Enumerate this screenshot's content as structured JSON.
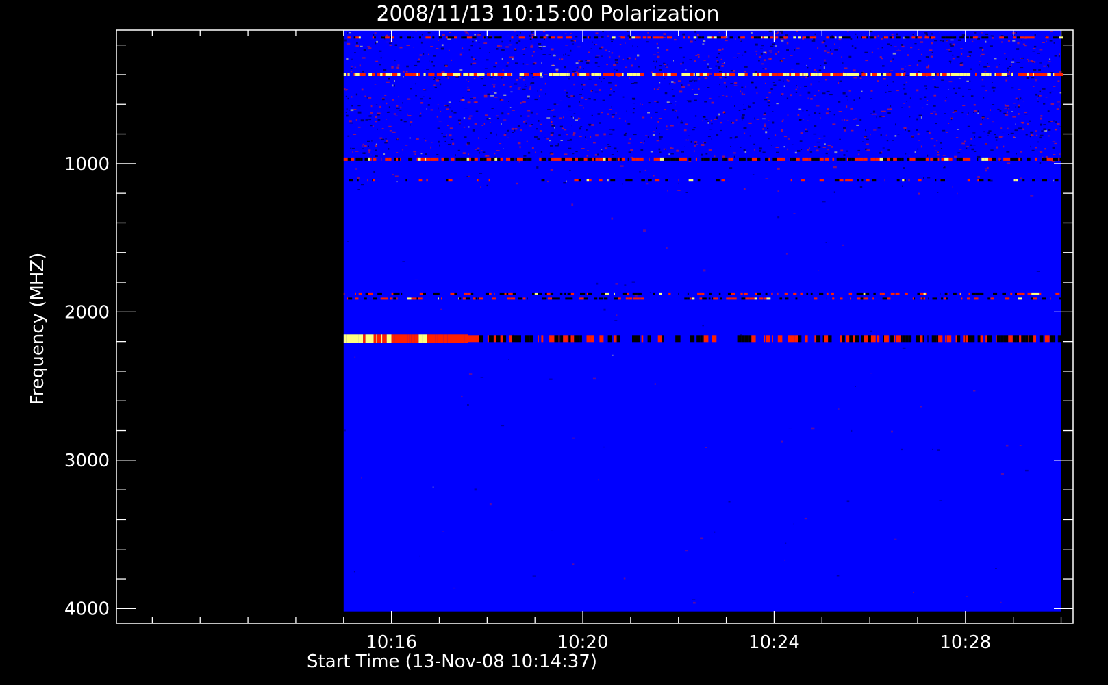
{
  "chart_data": {
    "type": "heatmap",
    "title": "2008/11/13 10:15:00 Polarization",
    "xlabel": "Start Time (13-Nov-08 10:14:37)",
    "ylabel": "Frequency (MHZ)",
    "x_range_minutes": [
      10.25,
      30.25
    ],
    "x_data_range_minutes": [
      15.0,
      30.0
    ],
    "y_range": [
      4100,
      100
    ],
    "y_data_range": [
      100,
      4020
    ],
    "x_ticks": [
      {
        "label": "10:16",
        "value": 16
      },
      {
        "label": "10:20",
        "value": 20
      },
      {
        "label": "10:24",
        "value": 24
      },
      {
        "label": "10:28",
        "value": 28
      }
    ],
    "y_ticks": [
      {
        "label": "1000",
        "value": 1000
      },
      {
        "label": "2000",
        "value": 2000
      },
      {
        "label": "3000",
        "value": 3000
      },
      {
        "label": "4000",
        "value": 4000
      }
    ],
    "colors": {
      "background": "#0000ff",
      "low": "#000000",
      "mid": "#ff2000",
      "high": "#ffff80"
    },
    "features": [
      {
        "name": "noisy band",
        "f_start": 100,
        "f_end": 950
      },
      {
        "name": "strong line near 400 MHz",
        "f_center": 400
      },
      {
        "name": "interference line near 970 MHz",
        "f_center": 970
      },
      {
        "name": "line near 1900 MHz",
        "f_center": 1900
      },
      {
        "name": "bright burst near 2180 MHz",
        "f_center": 2180,
        "t_start": 15.0,
        "t_end": 17.5
      }
    ]
  }
}
